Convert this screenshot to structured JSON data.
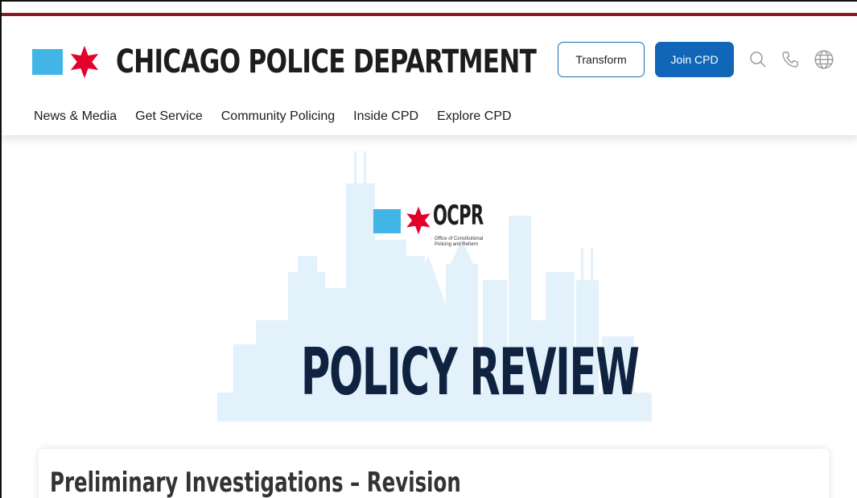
{
  "header": {
    "site_title": "CHICAGO POLICE DEPARTMENT",
    "transform_label": "Transform",
    "join_label": "Join CPD",
    "icons": [
      "search-icon",
      "phone-icon",
      "globe-icon"
    ],
    "colors": {
      "accent_red": "#8e1b24",
      "brand_blue": "#41b6e6",
      "star_red": "#e4002b",
      "join_button": "#1166b8"
    }
  },
  "nav": {
    "items": [
      "News & Media",
      "Get Service",
      "Community Policing",
      "Inside CPD",
      "Explore CPD"
    ]
  },
  "hero": {
    "ocpr_title": "OCPR",
    "ocpr_subtitle": "Office of Constitutional Policing and Reform",
    "banner_title": "POLICY REVIEW"
  },
  "content": {
    "card_title": "Preliminary Investigations – Revision"
  }
}
